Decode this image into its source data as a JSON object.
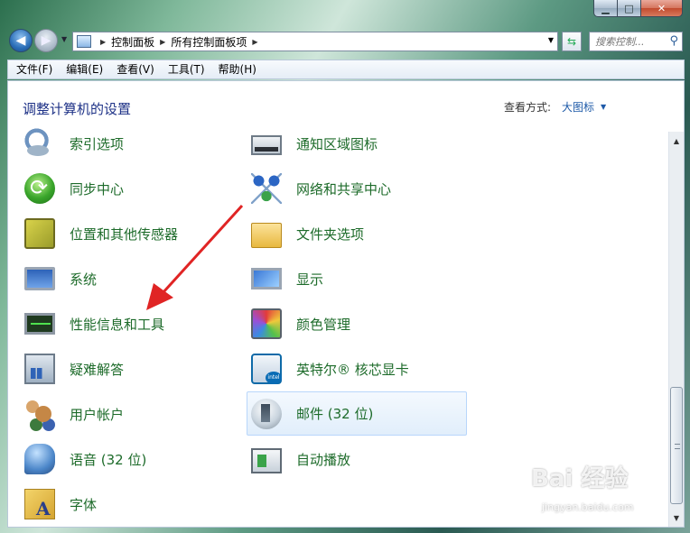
{
  "window": {
    "caption_min": "▁",
    "caption_max": "□",
    "caption_close": "✕"
  },
  "nav": {
    "breadcrumb": [
      "控制面板",
      "所有控制面板项"
    ],
    "search_placeholder": "搜索控制..."
  },
  "menu": [
    "文件(F)",
    "编辑(E)",
    "查看(V)",
    "工具(T)",
    "帮助(H)"
  ],
  "content": {
    "title": "调整计算机的设置",
    "view_by_label": "查看方式:",
    "view_by_value": "大图标"
  },
  "items_left": [
    {
      "label": "索引选项",
      "icon": "magnifier-icon"
    },
    {
      "label": "同步中心",
      "icon": "sync-icon"
    },
    {
      "label": "位置和其他传感器",
      "icon": "location-sensor-icon"
    },
    {
      "label": "系统",
      "icon": "system-icon"
    },
    {
      "label": "性能信息和工具",
      "icon": "performance-icon"
    },
    {
      "label": "疑难解答",
      "icon": "troubleshoot-icon"
    },
    {
      "label": "用户帐户",
      "icon": "users-icon"
    },
    {
      "label": "语音 (32 位)",
      "icon": "speech-icon"
    },
    {
      "label": "字体",
      "icon": "font-icon"
    }
  ],
  "items_right": [
    {
      "label": "通知区域图标",
      "icon": "notification-area-icon"
    },
    {
      "label": "网络和共享中心",
      "icon": "network-icon"
    },
    {
      "label": "文件夹选项",
      "icon": "folder-icon"
    },
    {
      "label": "显示",
      "icon": "display-icon"
    },
    {
      "label": "颜色管理",
      "icon": "color-management-icon"
    },
    {
      "label": "英特尔® 核芯显卡",
      "icon": "intel-graphics-icon"
    },
    {
      "label": "邮件 (32 位)",
      "icon": "mail-icon"
    },
    {
      "label": "自动播放",
      "icon": "autoplay-icon"
    }
  ],
  "watermark": {
    "brand": "Bai 经验",
    "url": "jingyan.baidu.com"
  },
  "colors": {
    "item_text": "#1d6b2a",
    "title_text": "#1e3287",
    "link": "#1e5aa8",
    "annotation_arrow": "#e02424"
  }
}
